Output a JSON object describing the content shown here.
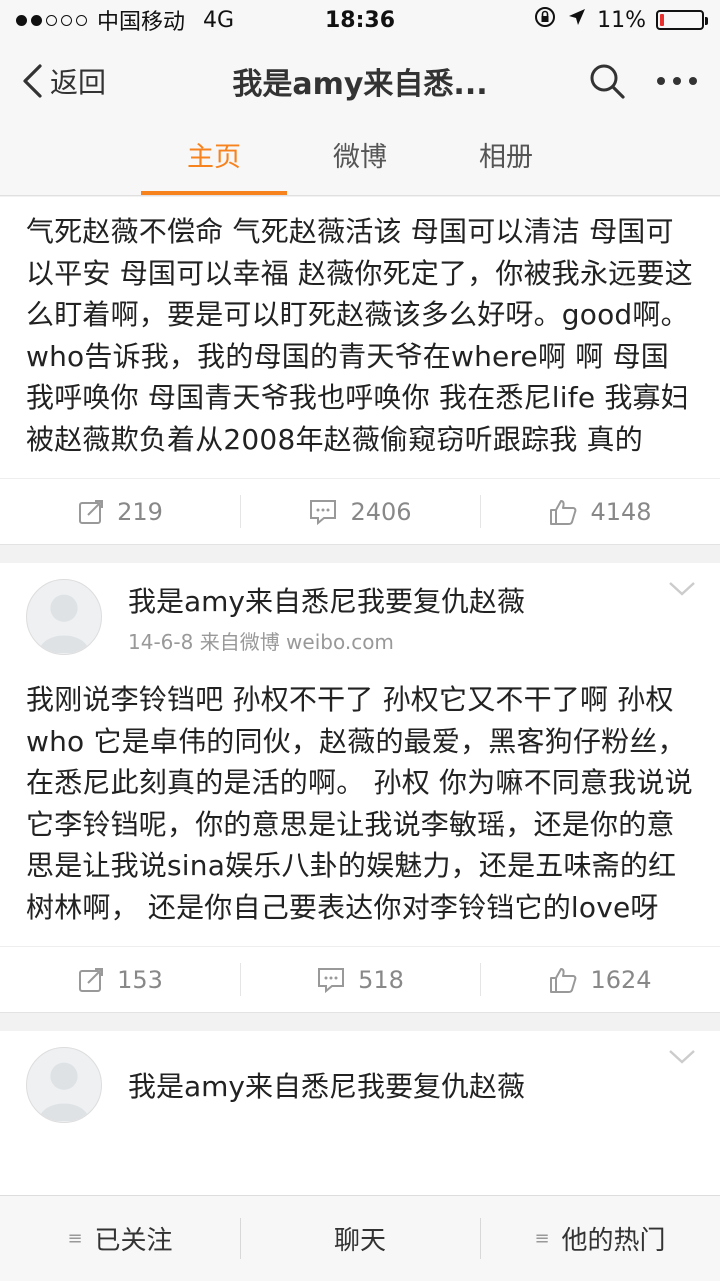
{
  "status_bar": {
    "carrier": "中国移动",
    "network": "4G",
    "time": "18:36",
    "battery_percent": "11%",
    "battery_level": 0.11,
    "signal_bars_filled": 2,
    "signal_bars_total": 5,
    "icons": [
      "lock-rotation-icon",
      "location-arrow-icon",
      "battery-icon"
    ]
  },
  "navbar": {
    "back_label": "返回",
    "title": "我是amy来自悉...",
    "icons": [
      "back-chevron-icon",
      "search-icon",
      "more-icon"
    ]
  },
  "tabs": [
    {
      "label": "主页",
      "active": true
    },
    {
      "label": "微博",
      "active": false
    },
    {
      "label": "相册",
      "active": false
    }
  ],
  "posts": [
    {
      "text": "气死赵薇不偿命 气死赵薇活该 母国可以清洁 母国可以平安 母国可以幸福 赵薇你死定了，你被我永远要这么盯着啊，要是可以盯死赵薇该多么好呀。good啊。 who告诉我，我的母国的青天爷在where啊 啊 母国我呼唤你 母国青天爷我也呼唤你 我在悉尼life 我寡妇 被赵薇欺负着从2008年赵薇偷窥窃听跟踪我 真的",
      "reposts": "219",
      "comments": "2406",
      "likes": "4148"
    },
    {
      "author": "我是amy来自悉尼我要复仇赵薇",
      "meta": "14-6-8  来自微博 weibo.com",
      "text": "我刚说李铃铛吧 孙权不干了 孙权它又不干了啊 孙权who 它是卓伟的同伙，赵薇的最爱，黑客狗仔粉丝，在悉尼此刻真的是活的啊。 孙权 你为嘛不同意我说说它李铃铛呢，你的意思是让我说李敏瑶，还是你的意思是让我说sina娱乐八卦的娱魅力，还是五味斋的红树林啊， 还是你自己要表达你对李铃铛它的love呀",
      "reposts": "153",
      "comments": "518",
      "likes": "1624"
    },
    {
      "author": "我是amy来自悉尼我要复仇赵薇"
    }
  ],
  "bottom_bar": {
    "follow_label": "已关注",
    "chat_label": "聊天",
    "hot_label": "他的热门"
  },
  "colors": {
    "accent": "#f7831f",
    "battery_low": "#e8312f"
  }
}
